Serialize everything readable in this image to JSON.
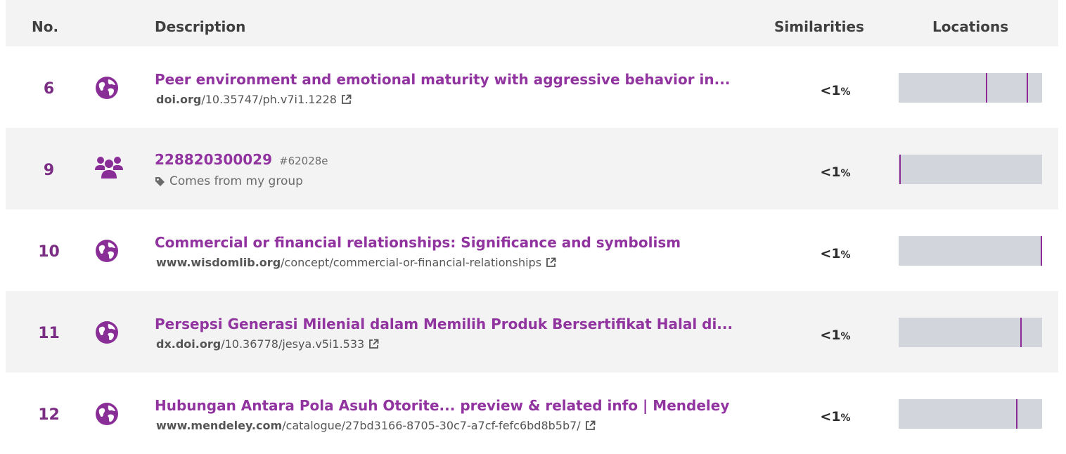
{
  "header": {
    "no": "No.",
    "description": "Description",
    "similarities": "Similarities",
    "locations": "Locations"
  },
  "colors": {
    "accent": "#9134a0",
    "number": "#7b2d84",
    "bar": "#d2d5dc",
    "marker": "#8c2b95"
  },
  "rows": [
    {
      "number": "6",
      "icon": "globe-icon",
      "title": "Peer environment and emotional maturity with aggressive behavior in...",
      "link_domain": "doi.org",
      "link_path": "/10.35747/ph.v7i1.1228",
      "similarity": "<1",
      "unit": "%",
      "markers": [
        0.61,
        0.89
      ]
    },
    {
      "number": "9",
      "icon": "group-icon",
      "title": "228820300029",
      "hash": "#62028e",
      "tag": "Comes from my group",
      "similarity": "<1",
      "unit": "%",
      "markers": [
        0.005
      ]
    },
    {
      "number": "10",
      "icon": "globe-icon",
      "title": "Commercial or financial relationships: Significance and symbolism",
      "link_domain": "www.wisdomlib.org",
      "link_path": "/concept/commercial-or-financial-relationships",
      "similarity": "<1",
      "unit": "%",
      "markers": [
        0.995
      ]
    },
    {
      "number": "11",
      "icon": "globe-icon",
      "title": "Persepsi Generasi Milenial dalam Memilih Produk Bersertifikat Halal di...",
      "link_domain": "dx.doi.org",
      "link_path": "/10.36778/jesya.v5i1.533",
      "similarity": "<1",
      "unit": "%",
      "markers": [
        0.85
      ]
    },
    {
      "number": "12",
      "icon": "globe-icon",
      "title": "Hubungan Antara Pola Asuh Otorite... preview & related info | Mendeley",
      "link_domain": "www.mendeley.com",
      "link_path": "/catalogue/27bd3166-8705-30c7-a7cf-fefc6bd8b5b7/",
      "similarity": "<1",
      "unit": "%",
      "markers": [
        0.82
      ]
    }
  ]
}
